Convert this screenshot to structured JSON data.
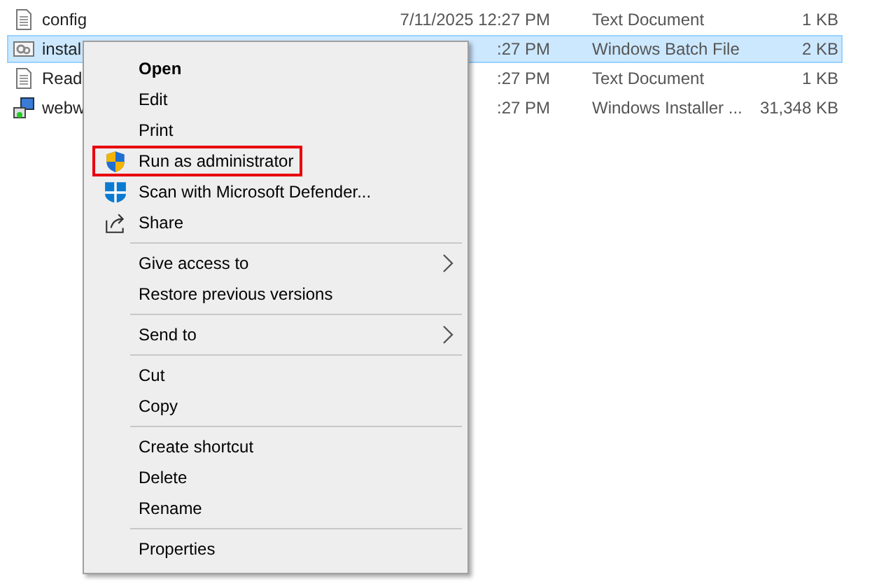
{
  "files": [
    {
      "kind": "text",
      "name": "config",
      "date": "7/11/2025 12:27 PM",
      "type": "Text Document",
      "size": "1 KB",
      "selected": false
    },
    {
      "kind": "batch",
      "name": "instal",
      "date": ":27 PM",
      "type": "Windows Batch File",
      "size": "2 KB",
      "selected": true
    },
    {
      "kind": "text",
      "name": "Read",
      "date": ":27 PM",
      "type": "Text Document",
      "size": "1 KB",
      "selected": false
    },
    {
      "kind": "installer",
      "name": "webw",
      "date": ":27 PM",
      "type": "Windows Installer ...",
      "size": "31,348 KB",
      "selected": false
    }
  ],
  "context_menu": [
    {
      "kind": "item",
      "label": "Open",
      "default": true,
      "highlighted": false
    },
    {
      "kind": "item",
      "label": "Edit",
      "default": false,
      "highlighted": false
    },
    {
      "kind": "item",
      "label": "Print",
      "default": false,
      "highlighted": false
    },
    {
      "kind": "admin",
      "label": "Run as administrator",
      "default": false,
      "highlighted": true
    },
    {
      "kind": "scan",
      "label": "Scan with Microsoft Defender...",
      "default": false,
      "highlighted": false
    },
    {
      "kind": "share",
      "label": "Share",
      "default": false,
      "highlighted": false
    },
    {
      "kind": "separator"
    },
    {
      "kind": "submenu",
      "label": "Give access to",
      "default": false,
      "highlighted": false
    },
    {
      "kind": "item",
      "label": "Restore previous versions",
      "default": false,
      "highlighted": false
    },
    {
      "kind": "separator"
    },
    {
      "kind": "submenu",
      "label": "Send to",
      "default": false,
      "highlighted": false
    },
    {
      "kind": "separator"
    },
    {
      "kind": "item",
      "label": "Cut",
      "default": false,
      "highlighted": false
    },
    {
      "kind": "item",
      "label": "Copy",
      "default": false,
      "highlighted": false
    },
    {
      "kind": "separator"
    },
    {
      "kind": "item",
      "label": "Create shortcut",
      "default": false,
      "highlighted": false
    },
    {
      "kind": "item",
      "label": "Delete",
      "default": false,
      "highlighted": false
    },
    {
      "kind": "item",
      "label": "Rename",
      "default": false,
      "highlighted": false
    },
    {
      "kind": "separator"
    },
    {
      "kind": "item",
      "label": "Properties",
      "default": false,
      "highlighted": false
    }
  ]
}
